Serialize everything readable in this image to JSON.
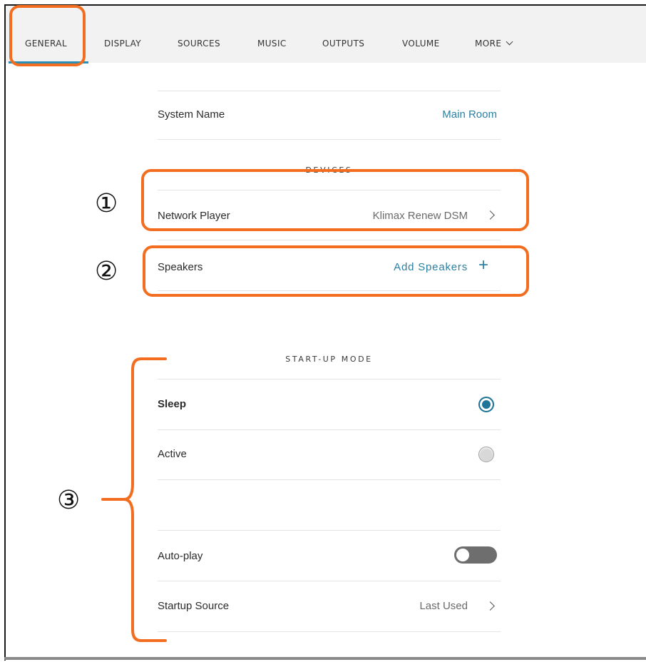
{
  "tabs": {
    "general": "GENERAL",
    "display": "DISPLAY",
    "sources": "SOURCES",
    "music": "MUSIC",
    "outputs": "OUTPUTS",
    "volume": "VOLUME",
    "more": "MORE"
  },
  "active_tab": "general",
  "system": {
    "label": "System Name",
    "value": "Main Room"
  },
  "devices": {
    "heading": "DEVICES",
    "network_player": {
      "label": "Network Player",
      "value": "Klimax Renew DSM"
    },
    "speakers": {
      "label": "Speakers",
      "action": "Add Speakers"
    }
  },
  "startup_mode": {
    "heading": "START-UP MODE",
    "options": [
      {
        "label": "Sleep",
        "selected": true
      },
      {
        "label": "Active",
        "selected": false
      }
    ],
    "auto_play": {
      "label": "Auto-play",
      "on": false
    },
    "startup_source": {
      "label": "Startup Source",
      "value": "Last Used"
    }
  },
  "annotations": {
    "marker_1": "①",
    "marker_2": "②",
    "marker_3": "③"
  },
  "colors": {
    "accent": "#2b7fa3",
    "callout": "#f26d1f",
    "tab_bar": "#f2f2f2",
    "radio_on": "#1f7497"
  }
}
